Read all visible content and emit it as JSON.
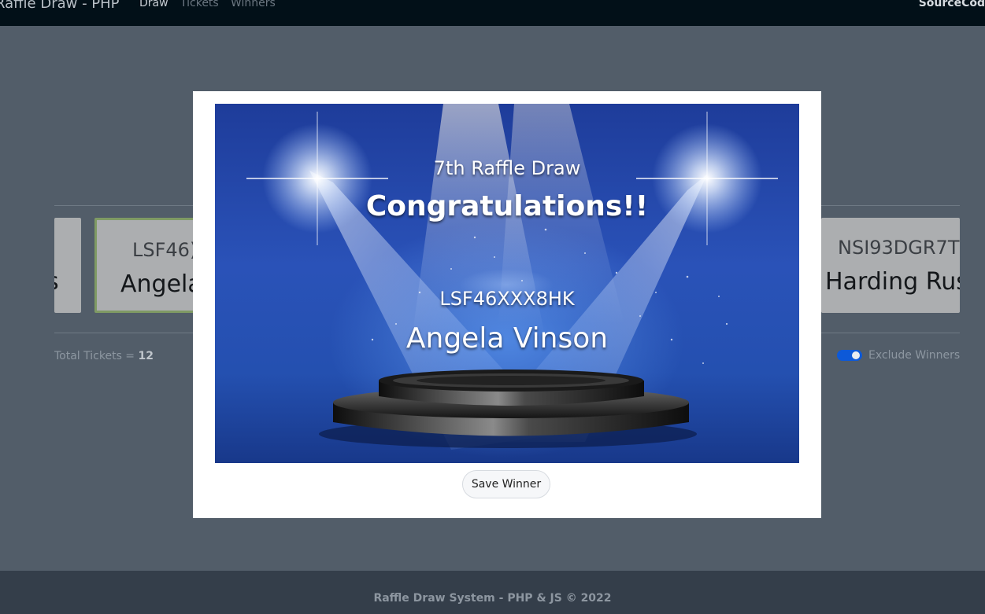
{
  "nav": {
    "brand": "Raffle Draw - PHP",
    "links": [
      "Draw",
      "Tickets",
      "Winners"
    ],
    "right_text": "SourceCod"
  },
  "cards": [
    {
      "code": "",
      "name": "s"
    },
    {
      "code": "LSF46)",
      "name": "Angela"
    },
    {
      "code": "NSI93DGR7T",
      "name": "Harding Rus"
    }
  ],
  "stats": {
    "total_label": "Total Tickets = ",
    "total_value": "12",
    "exclude_label": "Exclude Winners"
  },
  "modal": {
    "draw_title": "7th Raffle Draw",
    "congrats": "Congratulations!!",
    "ticket_code": "LSF46XXX8HK",
    "winner_name": "Angela Vinson",
    "save_button": "Save Winner"
  },
  "footer": {
    "text": "Raffle Draw System - PHP & JS © 2022"
  }
}
